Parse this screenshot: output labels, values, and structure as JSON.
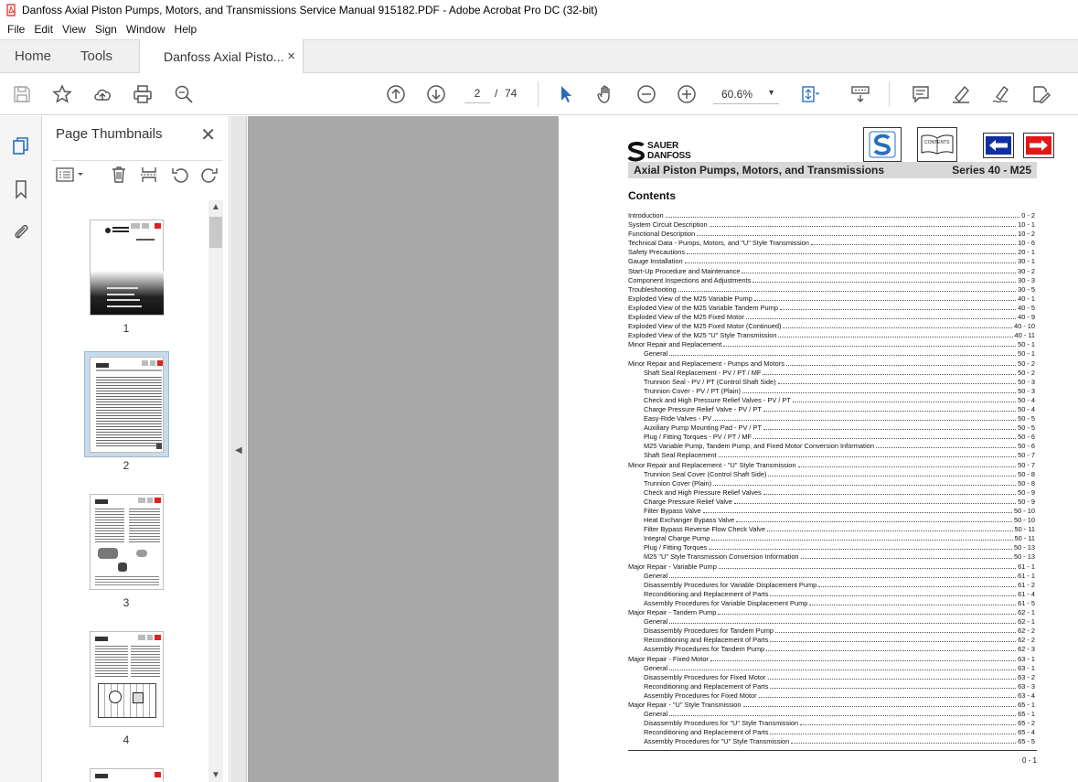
{
  "window": {
    "title": "Danfoss Axial Piston Pumps, Motors, and Transmissions Service Manual 915182.PDF - Adobe Acrobat Pro DC (32-bit)"
  },
  "menu": [
    "File",
    "Edit",
    "View",
    "Sign",
    "Window",
    "Help"
  ],
  "tabs": {
    "home": "Home",
    "tools": "Tools",
    "document": "Danfoss Axial Pisto...",
    "close": "×"
  },
  "toolbar": {
    "current_page": "2",
    "page_separator": "/",
    "total_pages": "74",
    "zoom": "60.6%"
  },
  "thumbnails_panel": {
    "title": "Page Thumbnails",
    "close": "✕",
    "pages": [
      "1",
      "2",
      "3",
      "4"
    ],
    "selected_page": "2"
  },
  "colors": {
    "accent_blue": "#2a6ebb",
    "selected_thumb": "#c8dbea",
    "doc_background": "#a8a8a8",
    "header_band": "#d8d8d8",
    "nav_red": "#e01818",
    "nav_blue": "#1030a0"
  },
  "pdf": {
    "brand_line1": "SAUER",
    "brand_line2": "DANFOSS",
    "contents_icon_label": "CONTENTS",
    "header_left": "Axial Piston Pumps, Motors, and Transmissions",
    "header_right": "Series 40 - M25",
    "heading": "Contents",
    "footer_page": "0 - 1",
    "toc": [
      {
        "title": "Introduction",
        "page": "0 - 2",
        "indent": false
      },
      {
        "title": "System Circuit Description",
        "page": "10 - 1",
        "indent": false
      },
      {
        "title": "Functional Description",
        "page": "10 - 2",
        "indent": false
      },
      {
        "title": "Technical Data - Pumps, Motors, and \"U\" Style Transmission",
        "page": "10 - 6",
        "indent": false
      },
      {
        "title": "Safety Precautions",
        "page": "20 - 1",
        "indent": false
      },
      {
        "title": "Gauge Installation",
        "page": "30 - 1",
        "indent": false
      },
      {
        "title": "Start-Up Procedure and Maintenance",
        "page": "30 - 2",
        "indent": false
      },
      {
        "title": "Component Inspections and Adjustments",
        "page": "30 - 3",
        "indent": false
      },
      {
        "title": "Troubleshooting",
        "page": "30 - 5",
        "indent": false
      },
      {
        "title": "Exploded View of the M25 Variable Pump",
        "page": "40 - 1",
        "indent": false
      },
      {
        "title": "Exploded View of the M25 Variable Tandem Pump",
        "page": "40 - 5",
        "indent": false
      },
      {
        "title": "Exploded View of the M25 Fixed Motor",
        "page": "40 - 9",
        "indent": false
      },
      {
        "title": "Exploded View of the M25 Fixed Motor (Continued)",
        "page": "40 - 10",
        "indent": false
      },
      {
        "title": "Exploded View of the M25 \"U\" Style Transmission",
        "page": "40 - 11",
        "indent": false
      },
      {
        "title": "Minor Repair and Replacement",
        "page": "50 - 1",
        "indent": false
      },
      {
        "title": "General",
        "page": "50 - 1",
        "indent": true
      },
      {
        "title": "Minor Repair and Replacement - Pumps and Motors",
        "page": "50 - 2",
        "indent": false
      },
      {
        "title": "Shaft Seal Replacement - PV / PT / MF",
        "page": "50 - 2",
        "indent": true
      },
      {
        "title": "Trunnion Seal - PV / PT (Control Shaft Side)",
        "page": "50 - 3",
        "indent": true
      },
      {
        "title": "Trunnion Cover - PV / PT (Plain)",
        "page": "50 - 3",
        "indent": true
      },
      {
        "title": "Check and High Pressure Relief Valves - PV / PT",
        "page": "50 - 4",
        "indent": true
      },
      {
        "title": "Charge Pressure Relief Valve - PV / PT",
        "page": "50 - 4",
        "indent": true
      },
      {
        "title": "Easy-Ride Valves - PV",
        "page": "50 - 5",
        "indent": true
      },
      {
        "title": "Auxiliary Pump Mounting Pad - PV / PT",
        "page": "50 - 5",
        "indent": true
      },
      {
        "title": "Plug / Fitting Torques - PV / PT / MF",
        "page": "50 - 6",
        "indent": true
      },
      {
        "title": "M25 Variable Pump, Tandem Pump, and Fixed Motor Conversion Information",
        "page": "50 - 6",
        "indent": true
      },
      {
        "title": "Shaft Seal Replacement",
        "page": "50 - 7",
        "indent": true
      },
      {
        "title": "Minor Repair and Replacement - \"U\" Style Transmission",
        "page": "50 - 7",
        "indent": false
      },
      {
        "title": "Trunnion Seal Cover (Control Shaft Side)",
        "page": "50 - 8",
        "indent": true
      },
      {
        "title": "Trunnion Cover (Plain)",
        "page": "50 - 8",
        "indent": true
      },
      {
        "title": "Check and High Pressure Relief Valves",
        "page": "50 - 9",
        "indent": true
      },
      {
        "title": "Charge Pressure Relief Valve",
        "page": "50 - 9",
        "indent": true
      },
      {
        "title": "Filter Bypass Valve",
        "page": "50 - 10",
        "indent": true
      },
      {
        "title": "Heat Exchanger Bypass Valve",
        "page": "50 - 10",
        "indent": true
      },
      {
        "title": "Filter Bypass Reverse Flow Check Valve",
        "page": "50 - 11",
        "indent": true
      },
      {
        "title": "Integral Charge Pump",
        "page": "50 - 11",
        "indent": true
      },
      {
        "title": "Plug / Fitting Torques",
        "page": "50 - 13",
        "indent": true
      },
      {
        "title": "M25 \"U\" Style Transmission Conversion Information",
        "page": "50 - 13",
        "indent": true
      },
      {
        "title": "Major Repair - Variable Pump",
        "page": "61 - 1",
        "indent": false
      },
      {
        "title": "General",
        "page": "61 - 1",
        "indent": true
      },
      {
        "title": "Disassembly Procedures for Variable Displacement Pump",
        "page": "61 - 2",
        "indent": true
      },
      {
        "title": "Reconditioning and Replacement of Parts",
        "page": "61 - 4",
        "indent": true
      },
      {
        "title": "Assembly Procedures for Variable Displacement Pump",
        "page": "61 - 5",
        "indent": true
      },
      {
        "title": "Major Repair - Tandem Pump",
        "page": "62 - 1",
        "indent": false
      },
      {
        "title": "General",
        "page": "62 - 1",
        "indent": true
      },
      {
        "title": "Disassembly Procedures for Tandem Pump",
        "page": "62 - 2",
        "indent": true
      },
      {
        "title": "Reconditioning and Replacement of Parts",
        "page": "62 - 2",
        "indent": true
      },
      {
        "title": "Assembly Procedures for Tandem Pump",
        "page": "62 - 3",
        "indent": true
      },
      {
        "title": "Major Repair - Fixed Motor",
        "page": "63 - 1",
        "indent": false
      },
      {
        "title": "General",
        "page": "63 - 1",
        "indent": true
      },
      {
        "title": "Disassembly Procedures for Fixed Motor",
        "page": "63 - 2",
        "indent": true
      },
      {
        "title": "Reconditioning and Replacement of Parts",
        "page": "63 - 3",
        "indent": true
      },
      {
        "title": "Assembly Procedures for Fixed Motor",
        "page": "63 - 4",
        "indent": true
      },
      {
        "title": "Major Repair - \"U\" Style Transmission",
        "page": "65 - 1",
        "indent": false
      },
      {
        "title": "General",
        "page": "65 - 1",
        "indent": true
      },
      {
        "title": "Disassembly Procedures for \"U\" Style Transmission",
        "page": "65 - 2",
        "indent": true
      },
      {
        "title": "Reconditioning and Replacement of Parts",
        "page": "65 - 4",
        "indent": true
      },
      {
        "title": "Assembly Procedures for \"U\" Style Transmission",
        "page": "65 - 5",
        "indent": true
      }
    ]
  }
}
